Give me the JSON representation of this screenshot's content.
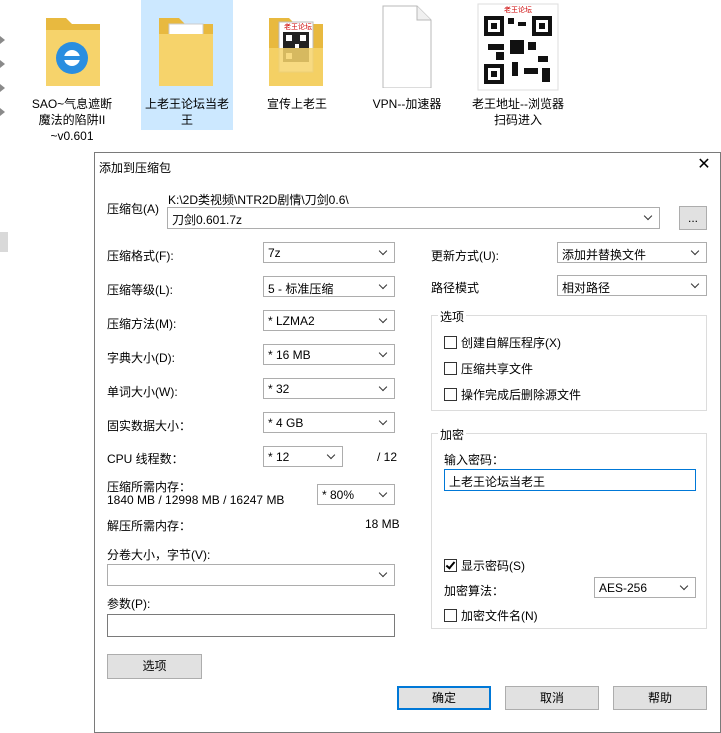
{
  "desktop": {
    "icons": [
      {
        "label": "SAO~气息遮断魔法的陷阱II ~v0.601",
        "icon": "ie-folder-icon"
      },
      {
        "label": "上老王论坛当老王",
        "icon": "folder-icon"
      },
      {
        "label": "宣传上老王",
        "icon": "qr-folder-icon"
      },
      {
        "label": "VPN--加速器",
        "icon": "document-icon"
      },
      {
        "label": "老王地址--浏览器扫码进入",
        "icon": "qr-image-icon"
      }
    ],
    "qr_caption": "老王论坛"
  },
  "dialog": {
    "title": "添加到压缩包",
    "archive_label": "压缩包(A)",
    "archive_path": "K:\\2D类视频\\NTR2D剧情\\刀剑0.6\\",
    "archive_name": "刀剑0.601.7z",
    "browse_label": "...",
    "format_label": "压缩格式(F):",
    "format_value": "7z",
    "level_label": "压缩等级(L):",
    "level_value": "5 - 标准压缩",
    "method_label": "压缩方法(M):",
    "method_value": "* LZMA2",
    "dict_label": "字典大小(D):",
    "dict_value": "* 16 MB",
    "word_label": "单词大小(W):",
    "word_value": "* 32",
    "solid_label": "固实数据大小：",
    "solid_value": "* 4 GB",
    "cpu_label": "CPU 线程数：",
    "cpu_value": "* 12",
    "cpu_max": "/ 12",
    "mem_label": "压缩所需内存：",
    "mem_detail": "1840 MB / 12998 MB / 16247 MB",
    "mem_value": "* 80%",
    "decomp_label": "解压所需内存：",
    "decomp_value": "18 MB",
    "volume_label": "分卷大小，字节(V):",
    "volume_value": "",
    "params_label": "参数(P):",
    "params_value": "",
    "options_button": "选项",
    "update_label": "更新方式(U):",
    "update_value": "添加并替换文件",
    "path_mode_label": "路径模式",
    "path_mode_value": "相对路径",
    "options_group": {
      "title": "选项",
      "items": [
        {
          "label": "创建自解压程序(X)",
          "checked": false
        },
        {
          "label": "压缩共享文件",
          "checked": false
        },
        {
          "label": "操作完成后删除源文件",
          "checked": false
        }
      ]
    },
    "encrypt_group": {
      "title": "加密",
      "password_label": "输入密码：",
      "password_value": "上老王论坛当老王",
      "show_password": "显示密码(S)",
      "show_password_checked": true,
      "algo_label": "加密算法：",
      "algo_value": "AES-256",
      "encrypt_names": "加密文件名(N)",
      "encrypt_names_checked": false
    },
    "ok_label": "确定",
    "cancel_label": "取消",
    "help_label": "帮助"
  }
}
